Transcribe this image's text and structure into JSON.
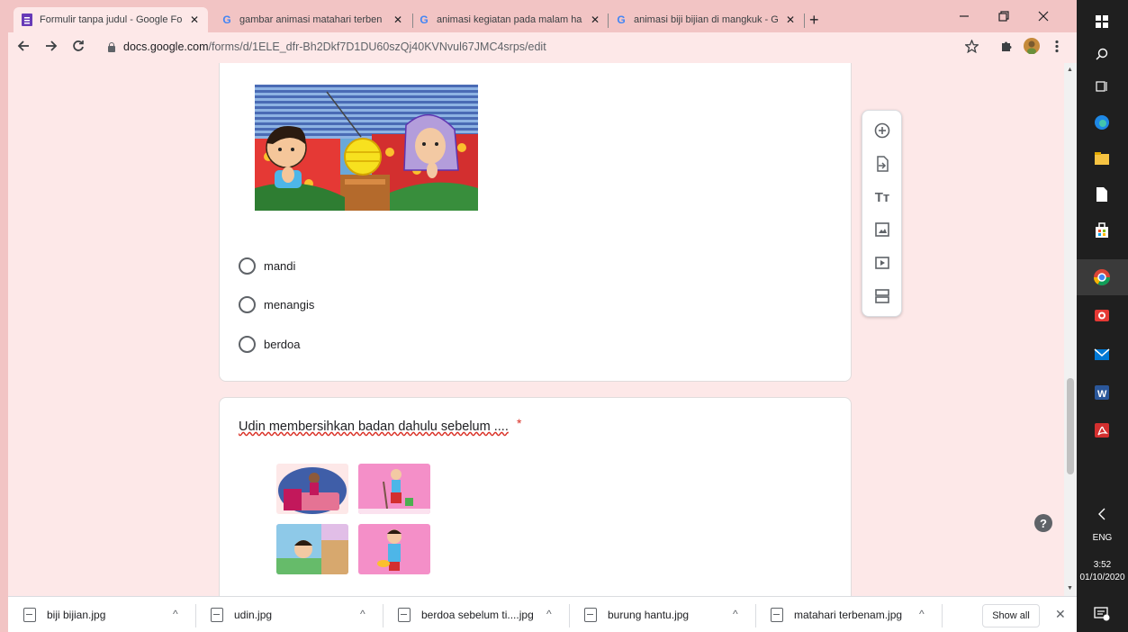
{
  "browser": {
    "tabs": [
      {
        "title": "Formulir tanpa judul - Google Fo",
        "favicon": "forms-icon",
        "active": true
      },
      {
        "title": "gambar animasi matahari terben",
        "favicon": "google-icon",
        "active": false
      },
      {
        "title": "animasi kegiatan pada malam ha",
        "favicon": "google-icon",
        "active": false
      },
      {
        "title": "animasi biji bijian di mangkuk - G",
        "favicon": "google-icon",
        "active": false
      }
    ],
    "close_glyph": "✕",
    "new_tab_glyph": "+",
    "url_host": "docs.google.com",
    "url_path": "/forms/d/1ELE_dfr-Bh2Dkf7D1DU60szQj40KVNvul67JMC4srps/edit"
  },
  "question1": {
    "options": [
      "mandi",
      "menangis",
      "berdoa"
    ]
  },
  "question2": {
    "title": "Udin membersihkan badan dahulu sebelum ....",
    "required_mark": "*"
  },
  "toolbar": {
    "items": [
      "add-question-icon",
      "import-questions-icon",
      "add-title-icon",
      "add-image-icon",
      "add-video-icon",
      "add-section-icon"
    ],
    "text_glyph": "Tт"
  },
  "help": {
    "glyph": "?"
  },
  "downloads": {
    "items": [
      "biji bijian.jpg",
      "udin.jpg",
      "berdoa sebelum ti....jpg",
      "burung hantu.jpg",
      "matahari terbenam.jpg"
    ],
    "show_all": "Show all",
    "close_glyph": "✕"
  },
  "taskbar": {
    "language": "ENG",
    "time": "3:52",
    "date": "01/10/2020"
  },
  "colors": {
    "accent_pink": "#f2c4c4",
    "forms_purple": "#673ab7",
    "required_red": "#d93025"
  }
}
